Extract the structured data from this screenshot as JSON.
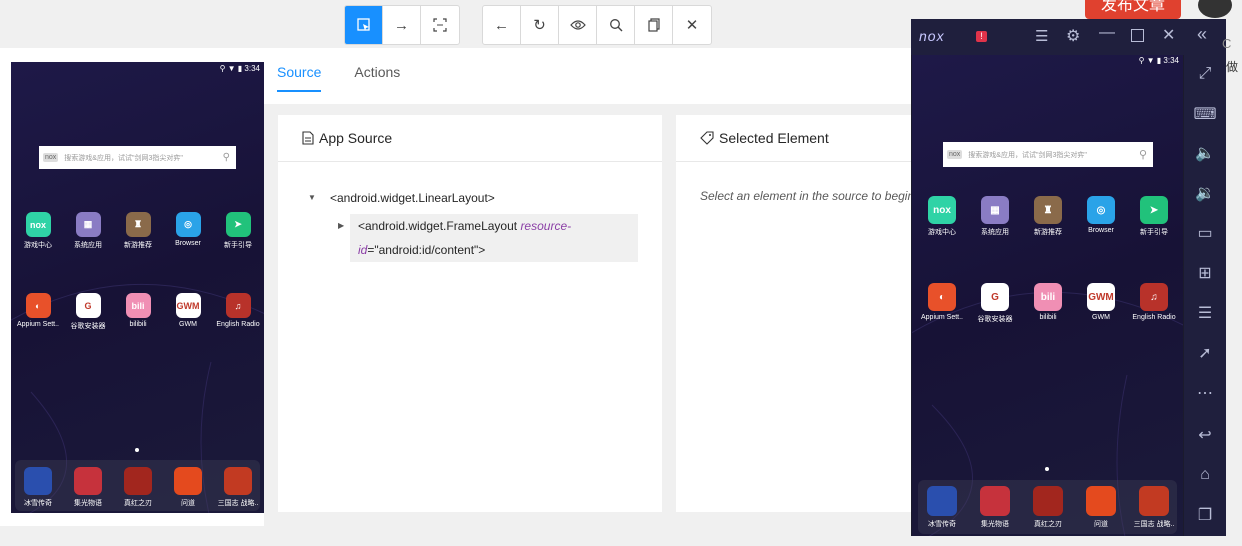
{
  "toolbar": {
    "group1": [
      {
        "name": "select-element",
        "icon": "⬚"
      },
      {
        "name": "swipe",
        "icon": "→"
      },
      {
        "name": "tap-coordinates",
        "icon": "⛶"
      }
    ],
    "group2": [
      {
        "name": "back",
        "icon": "←"
      },
      {
        "name": "refresh",
        "icon": "↻"
      },
      {
        "name": "search-element-eye",
        "icon": "◉"
      },
      {
        "name": "search",
        "icon": "⚲"
      },
      {
        "name": "copy-xml",
        "icon": "❐"
      },
      {
        "name": "quit-session",
        "icon": "✕"
      }
    ],
    "publish_label": "发布文章"
  },
  "tabs": {
    "source": "Source",
    "actions": "Actions"
  },
  "app_source": {
    "title": "App Source",
    "root_node": "<android.widget.LinearLayout>",
    "child_open": "<android.widget.FrameLayout ",
    "child_attr_name": "resource-id",
    "child_attr_eq": "=",
    "child_attr_value": "\"android:id/content\"",
    "child_close": ">"
  },
  "selected_element": {
    "title": "Selected Element",
    "placeholder": "Select an element in the source to begin."
  },
  "device": {
    "time": "3:34",
    "search_placeholder": "搜索游戏&应用，试试\"剑网3指尖对弈\"",
    "apps_row1": [
      {
        "label": "游戏中心",
        "color": "#2fd3a6",
        "glyph": "nox"
      },
      {
        "label": "系统应用",
        "color": "#8a7cc4",
        "glyph": "▦"
      },
      {
        "label": "新游推荐",
        "color": "#8a6a4a",
        "glyph": "♜"
      },
      {
        "label": "Browser",
        "color": "#2aa3e8",
        "glyph": "◎"
      },
      {
        "label": "新手引导",
        "color": "#21c27b",
        "glyph": "➤"
      }
    ],
    "apps_row2": [
      {
        "label": "Appium Sett..",
        "color": "#e8512a",
        "glyph": "◐"
      },
      {
        "label": "谷歌安装器",
        "color": "#ffffff",
        "glyph": "G"
      },
      {
        "label": "bilibili",
        "color": "#f08fb4",
        "glyph": "bili"
      },
      {
        "label": "GWM",
        "color": "#ffffff",
        "glyph": "GWM"
      },
      {
        "label": "English Radio",
        "color": "#b8322a",
        "glyph": "♫"
      }
    ],
    "dock": [
      {
        "label": "冰雪传奇",
        "color": "#2a4fae"
      },
      {
        "label": "集光物语",
        "color": "#c6323c"
      },
      {
        "label": "真红之刃",
        "color": "#a2261e"
      },
      {
        "label": "问道",
        "color": "#e44a1e"
      },
      {
        "label": "三国志 战略..",
        "color": "#c23a22"
      }
    ]
  },
  "nox": {
    "logo": "nox",
    "time": "3:34",
    "search_placeholder": "搜索游戏&应用，试试\"剑网3指尖对弈\""
  },
  "edge_text": {
    "c": "C",
    "zuo": "做"
  }
}
